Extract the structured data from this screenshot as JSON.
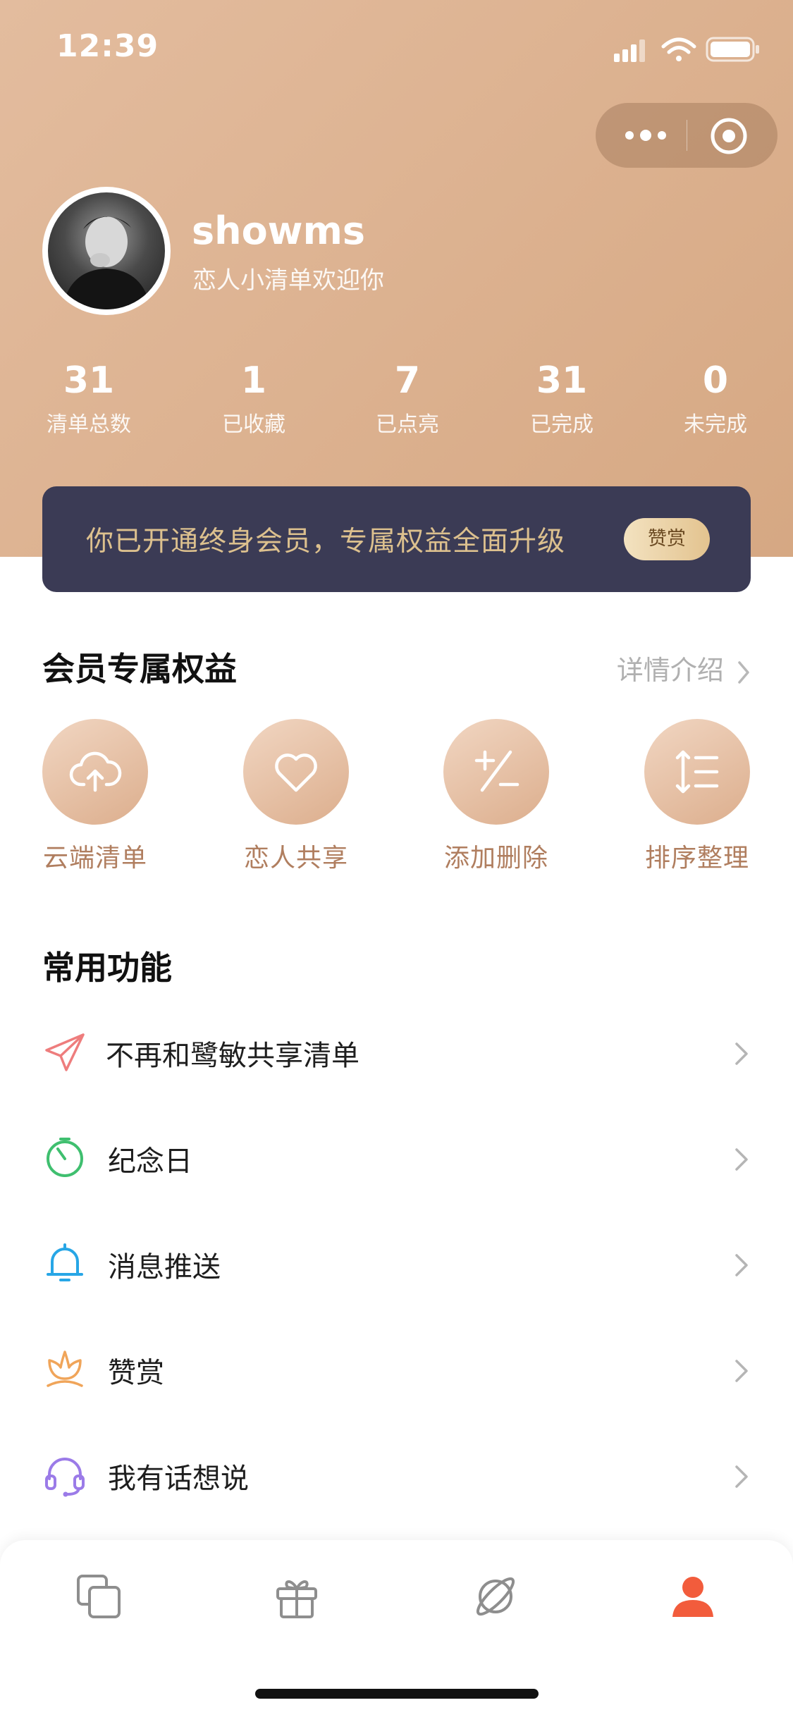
{
  "status_bar": {
    "time": "12:39"
  },
  "profile": {
    "username": "showms",
    "welcome": "恋人小清单欢迎你"
  },
  "stats": [
    {
      "value": "31",
      "label": "清单总数"
    },
    {
      "value": "1",
      "label": "已收藏"
    },
    {
      "value": "7",
      "label": "已点亮"
    },
    {
      "value": "31",
      "label": "已完成"
    },
    {
      "value": "0",
      "label": "未完成"
    }
  ],
  "vip_banner": {
    "text": "你已开通终身会员，专属权益全面升级",
    "badge": "赞赏"
  },
  "perks_section": {
    "title": "会员专属权益",
    "detail_link": "详情介绍",
    "items": [
      {
        "label": "云端清单",
        "icon": "cloud-upload-icon"
      },
      {
        "label": "恋人共享",
        "icon": "heart-icon"
      },
      {
        "label": "添加删除",
        "icon": "plus-minus-icon"
      },
      {
        "label": "排序整理",
        "icon": "sort-list-icon"
      }
    ]
  },
  "common_section": {
    "title": "常用功能",
    "items": [
      {
        "label": "不再和鹭敏共享清单",
        "icon": "paper-plane-icon",
        "color": "#ee7d7d"
      },
      {
        "label": "纪念日",
        "icon": "timer-icon",
        "color": "#3fbf6f"
      },
      {
        "label": "消息推送",
        "icon": "bell-icon",
        "color": "#27a6e6"
      },
      {
        "label": "赞赏",
        "icon": "lotus-icon",
        "color": "#f0a55a"
      },
      {
        "label": "我有话想说",
        "icon": "headset-icon",
        "color": "#9b7be8"
      }
    ]
  },
  "tabbar": {
    "tabs": [
      {
        "icon": "cards-icon"
      },
      {
        "icon": "gift-icon"
      },
      {
        "icon": "planet-icon"
      },
      {
        "icon": "profile-icon",
        "active": true
      }
    ],
    "active_color": "#f25c3c"
  }
}
